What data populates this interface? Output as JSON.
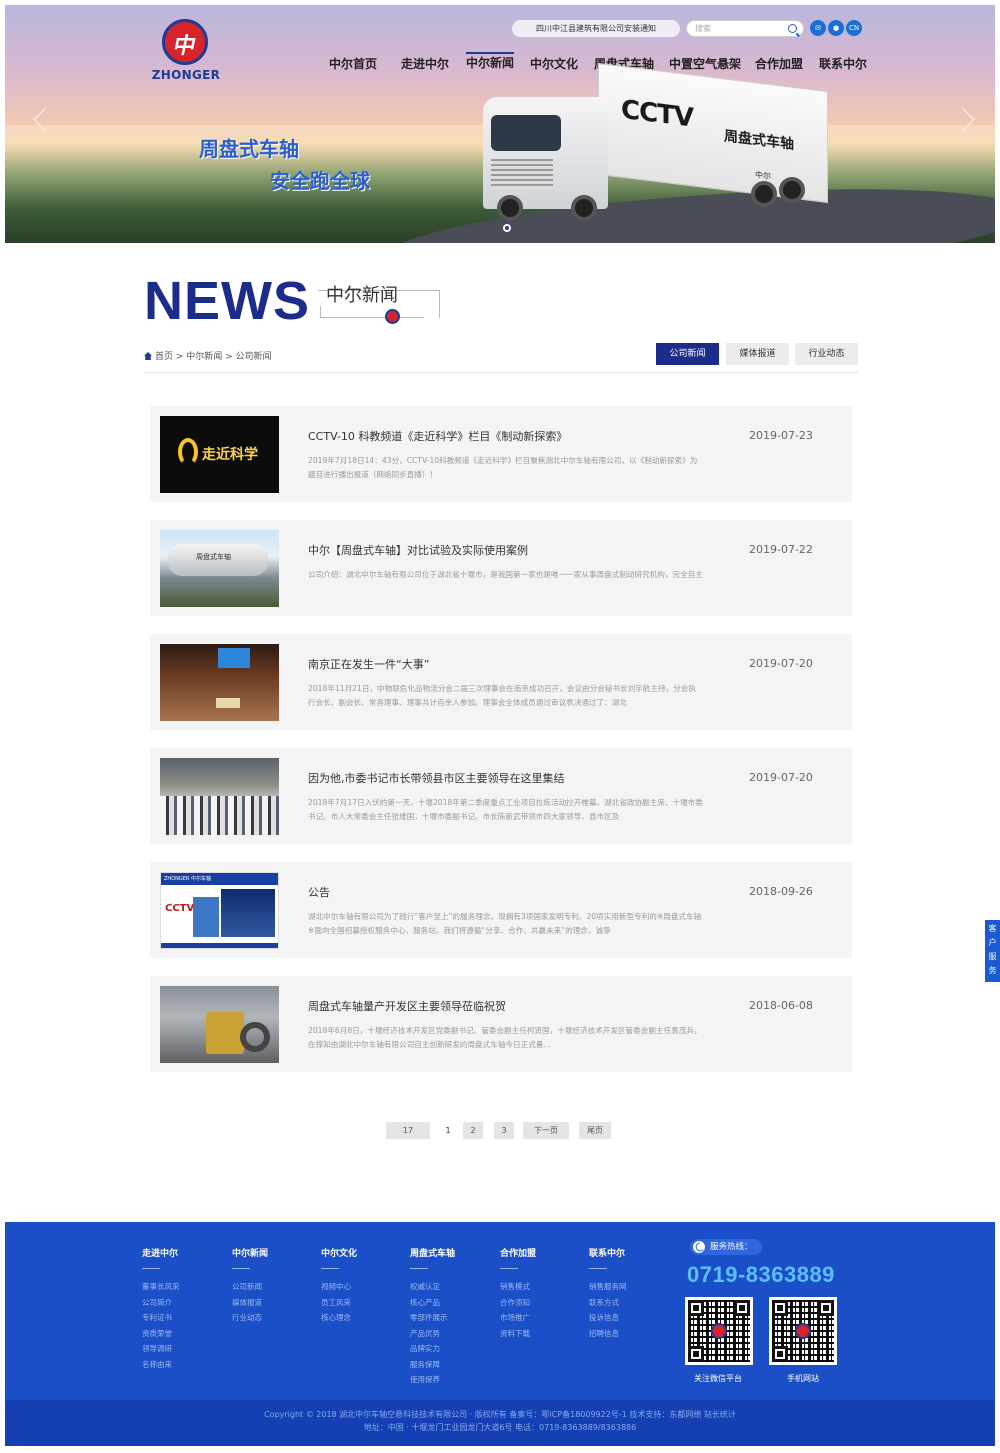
{
  "brand": {
    "logo_mark": "中",
    "name": "ZHONGER"
  },
  "header": {
    "ticker": "四川中江县建筑有限公司安装通知",
    "search_placeholder": "搜索",
    "icons": [
      "wechat-icon",
      "weibo-icon",
      "qq-icon"
    ],
    "lang": "CN",
    "nav": [
      "中尔首页",
      "走进中尔",
      "中尔新闻",
      "中尔文化",
      "周盘式车轴",
      "中置空气悬架",
      "合作加盟",
      "联系中尔"
    ],
    "nav_active": "中尔新闻"
  },
  "banner": {
    "slogan1": "周盘式车轴",
    "slogan2": "安全跑全球",
    "truck_brand": "CCTV",
    "truck_text": "周盘式车轴",
    "truck_small": "中尔"
  },
  "section": {
    "title_en": "NEWS",
    "title_cn": "中尔新闻",
    "breadcrumb": "首页 > 中尔新闻 > 公司新闻",
    "tabs": [
      "公司新闻",
      "媒体报道",
      "行业动态"
    ],
    "tab_active": "公司新闻"
  },
  "news": [
    {
      "title": "CCTV-10 科教频道《走近科学》栏目《制动新探索》",
      "date": "2019-07-23",
      "desc": "2019年7月18日14：43分，CCTV-10科教频道《走近科学》栏目聚焦湖北中尔车轴有限公司，以《制动新探索》为题目进行播出报道（网络同步直播）！",
      "thumb_text": "走近科学"
    },
    {
      "title": "中尔【周盘式车轴】对比试验及实际使用案例",
      "date": "2019-07-22",
      "desc": "公司介绍：湖北中尔车轴有限公司位于湖北省十堰市，是我国第一家也是唯一一家从事周盘式制动研究机构，完全自主",
      "thumb_text": "周盘式车轴"
    },
    {
      "title": "南京正在发生一件“大事”",
      "date": "2019-07-20",
      "desc": "2018年11月21日，中物联危化品物流分会二届三次理事会在南京成功召开，会议由分会秘书长刘宇航主持，分会执行会长、副会长、常务理事、理事共计百余人参加。理事会全体成员通过审议表决通过了：湖北",
      "thumb_text": ""
    },
    {
      "title": "因为他,市委书记市长带领县市区主要领导在这里集结",
      "date": "2019-07-20",
      "desc": "2018年7月17日入伏的第一天，十堰2018年第二季度重点工业项目拉练活动拉开帷幕。湖北省政协副主席、十堰市委书记、市人大常委会主任张维国，十堰市委副书记、市长陈新武带领市四大家领导、县市区及",
      "thumb_text": ""
    },
    {
      "title": "公告",
      "date": "2018-09-26",
      "desc": "湖北中尔车轴有限公司为了践行“客户至上”的服务理念，现拥有3项国家发明专利、20项实用新型专利的※周盘式车轴※面向全国招募授权服务中心、服务站。我们将遵循“分享、合作、共赢未来”的理念，诚挚",
      "thumb_text": "ZHONGER 中尔车轴"
    },
    {
      "title": "周盘式车轴量产开发区主要领导莅临祝贺",
      "date": "2018-06-08",
      "desc": "2018年6月8日，十堰经济技术开发区党委副书记、管委会副主任柯贤国，十堰经济技术开发区管委会副主任袁茂兵，在撑知由湖北中尔车轴有限公司自主创新研发的周盘式车轴今日正式量...",
      "thumb_text": ""
    }
  ],
  "pager": [
    "17",
    "1",
    "2",
    "3",
    "下一页",
    "尾页"
  ],
  "side_service": "客户服务",
  "footer": {
    "columns": [
      {
        "title": "走进中尔",
        "items": [
          "董事长风采",
          "公司简介",
          "专利证书",
          "资质荣誉",
          "领导调研",
          "名称由来"
        ]
      },
      {
        "title": "中尔新闻",
        "items": [
          "公司新闻",
          "媒体报道",
          "行业动态"
        ]
      },
      {
        "title": "中尔文化",
        "items": [
          "视频中心",
          "员工风采",
          "核心理念"
        ]
      },
      {
        "title": "周盘式车轴",
        "items": [
          "权威认定",
          "核心产品",
          "零部件展示",
          "产品优势",
          "品牌实力",
          "服务保障",
          "使用保养"
        ]
      },
      {
        "title": "合作加盟",
        "items": [
          "销售模式",
          "合作须知",
          "市场推广",
          "资料下载"
        ]
      },
      {
        "title": "联系中尔",
        "items": [
          "销售服务网",
          "联系方式",
          "投诉信息",
          "招聘信息"
        ]
      }
    ],
    "hotline_label": "服务热线：",
    "hotline": "0719-8363889",
    "qr_captions": [
      "关注微信平台",
      "手机网站"
    ],
    "copyright_line1": "Copyright © 2018 湖北中尔车轴空悬科技技术有限公司 · 版权所有 备案号：鄂ICP备18009922号-1 技术支持：东都网络 站长统计",
    "copyright_line2": "地址：中国 · 十堰龙门工业园龙门大道6号 电话：0719-8363889/8363886"
  }
}
